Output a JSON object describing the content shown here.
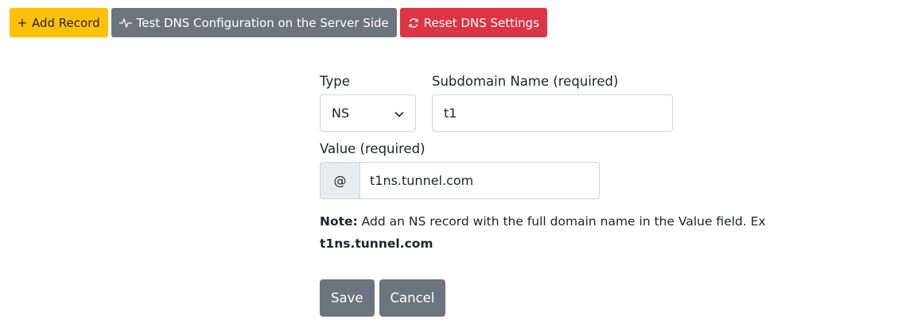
{
  "toolbar": {
    "add_record_label": "Add Record",
    "test_dns_label": "Test DNS Configuration on the Server Side",
    "reset_dns_label": "Reset DNS Settings"
  },
  "form": {
    "type_label": "Type",
    "type_value": "NS",
    "subdomain_label": "Subdomain Name (required)",
    "subdomain_value": "t1",
    "value_label": "Value (required)",
    "value_prefix": "@",
    "value_value": "t1ns.tunnel.com",
    "note_prefix": "Note:",
    "note_text": " Add an NS record with the full domain name in the Value field. Ex",
    "note_example": "t1ns.tunnel.com",
    "save_label": "Save",
    "cancel_label": "Cancel"
  },
  "colors": {
    "warning": "#ffc107",
    "secondary": "#6c757d",
    "danger": "#dc3545"
  },
  "icons": {
    "add": "plus-icon",
    "test": "pulse-icon",
    "reset": "refresh-icon",
    "select": "chevron-down-icon"
  }
}
